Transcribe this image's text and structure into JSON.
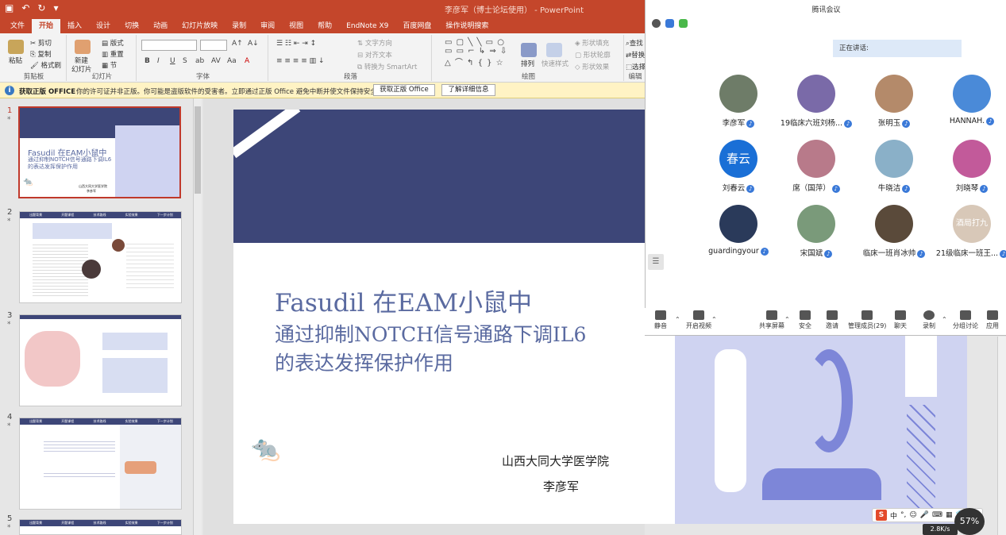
{
  "app": {
    "title": "李彦军（博士论坛使用） - PowerPoint",
    "qa_icons": [
      "save-icon",
      "undo-icon",
      "redo-icon",
      "customize-icon"
    ]
  },
  "tabs": [
    "文件",
    "开始",
    "插入",
    "设计",
    "切换",
    "动画",
    "幻灯片放映",
    "录制",
    "审阅",
    "视图",
    "帮助",
    "EndNote X9",
    "百度网盘",
    "操作说明搜索"
  ],
  "ribbon": {
    "clipboard": {
      "label": "剪贴板",
      "paste": "粘贴",
      "cut": "剪切",
      "copy": "复制",
      "painter": "格式刷"
    },
    "slides": {
      "label": "幻灯片",
      "new": "新建",
      "new2": "幻灯片",
      "layout": "版式",
      "reset": "重置",
      "section": "节"
    },
    "font": {
      "label": "字体",
      "buttons": [
        "B",
        "I",
        "U",
        "S",
        "ab",
        "AV",
        "Aa",
        "A"
      ]
    },
    "paragraph": {
      "label": "段落",
      "text_dir": "文字方向",
      "align_text": "对齐文本",
      "smartart": "转换为 SmartArt"
    },
    "drawing": {
      "label": "绘图",
      "arrange": "排列",
      "quick_styles": "快速样式",
      "fill": "形状填充",
      "outline": "形状轮廓",
      "effect": "形状效果"
    },
    "editing": {
      "label": "编辑",
      "find": "查找",
      "replace": "替换",
      "select": "选择"
    }
  },
  "warning": {
    "bold": "获取正版 OFFICE",
    "message": "你的许可证并非正版。你可能是盗版软件的受害者。立即通过正版 Office 避免中断并使文件保持安全。",
    "btn1": "获取正版 Office",
    "btn2": "了解详细信息"
  },
  "thumbnails": [
    {
      "num": "1",
      "title": "Fasudil 在EAM小鼠中",
      "sub": "通过抑制NOTCH信号通路下调IL6",
      "sub2": "的表达发挥保护作用",
      "inst": "山西大同大学医学院",
      "auth": "李彦军"
    },
    {
      "num": "2",
      "nav": [
        "出题背景",
        "开题课程",
        "技术路线",
        "实验效果",
        "下一步计划"
      ]
    },
    {
      "num": "3"
    },
    {
      "num": "4",
      "nav": [
        "出题背景",
        "开题课程",
        "技术路线",
        "实验效果",
        "下一步计划"
      ]
    },
    {
      "num": "5",
      "nav": [
        "出题背景",
        "开题课程",
        "技术路线",
        "实验效果",
        "下一步计划"
      ]
    }
  ],
  "slide": {
    "title": "Fasudil 在EAM小鼠中",
    "subtitle1": "通过抑制NOTCH信号通路下调IL6",
    "subtitle2": "的表达发挥保护作用",
    "institution": "山西大同大学医学院",
    "author": "李彦军"
  },
  "meeting": {
    "title": "腾讯会议",
    "speaking": "正在讲话:",
    "participants": [
      {
        "name": "李彦军",
        "color": "#6e7c68"
      },
      {
        "name": "19临床六班刘杨...",
        "color": "#7a6aa8"
      },
      {
        "name": "张明玉",
        "color": "#b48a6a"
      },
      {
        "name": "HANNAH.",
        "color": "#4a8ad8"
      },
      {
        "name": "刘春云",
        "color": "#1a6fd6",
        "text": "春云"
      },
      {
        "name": "席（国萍）",
        "color": "#b87a8a"
      },
      {
        "name": "牛晓洁",
        "color": "#8ab0c8"
      },
      {
        "name": "刘晓琴",
        "color": "#c25a9a"
      },
      {
        "name": "guardingyour",
        "color": "#2a3a5a"
      },
      {
        "name": "宋国斌",
        "color": "#7a9a7a"
      },
      {
        "name": "临床一班肖冰帅",
        "color": "#5a4a3a"
      },
      {
        "name": "21级临床一班王...",
        "color": "#d8c8b8",
        "text": "酒局打九"
      }
    ],
    "toolbar": [
      "静音",
      "开启视频",
      "共享屏幕",
      "安全",
      "邀请",
      "管理成员(29)",
      "聊天",
      "录制",
      "分组讨论",
      "应用"
    ]
  },
  "taskbar": {
    "ime": "中",
    "net": "2.8K/s",
    "pct": "57%"
  }
}
